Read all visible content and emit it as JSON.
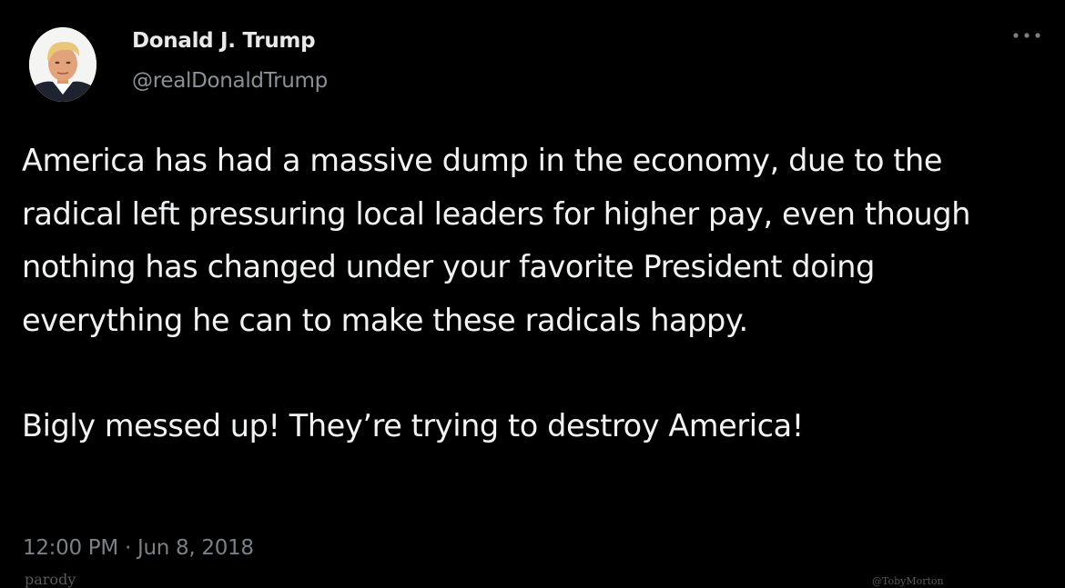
{
  "tweet": {
    "author": {
      "name": "Donald J. Trump",
      "handle": "@realDonaldTrump",
      "avatar_icon": "profile-photo"
    },
    "more_icon": "ellipsis-icon",
    "body": {
      "paragraph_1": "America has had a massive dump in the economy, due to the radical left pressuring local leaders for higher pay, even though nothing has changed under your favorite President doing everything he can to make these radicals happy.",
      "paragraph_2": "Bigly messed up! They’re trying to destroy America!"
    },
    "timestamp": {
      "time": "12:00 PM",
      "separator": "·",
      "date": "Jun 8, 2018"
    }
  },
  "watermarks": {
    "left": "parody",
    "right": "@TobyMorton"
  },
  "colors": {
    "background": "#000000",
    "name_text": "#e7e9ea",
    "secondary_text": "#8b9196",
    "body_text": "#f1f2f3"
  }
}
